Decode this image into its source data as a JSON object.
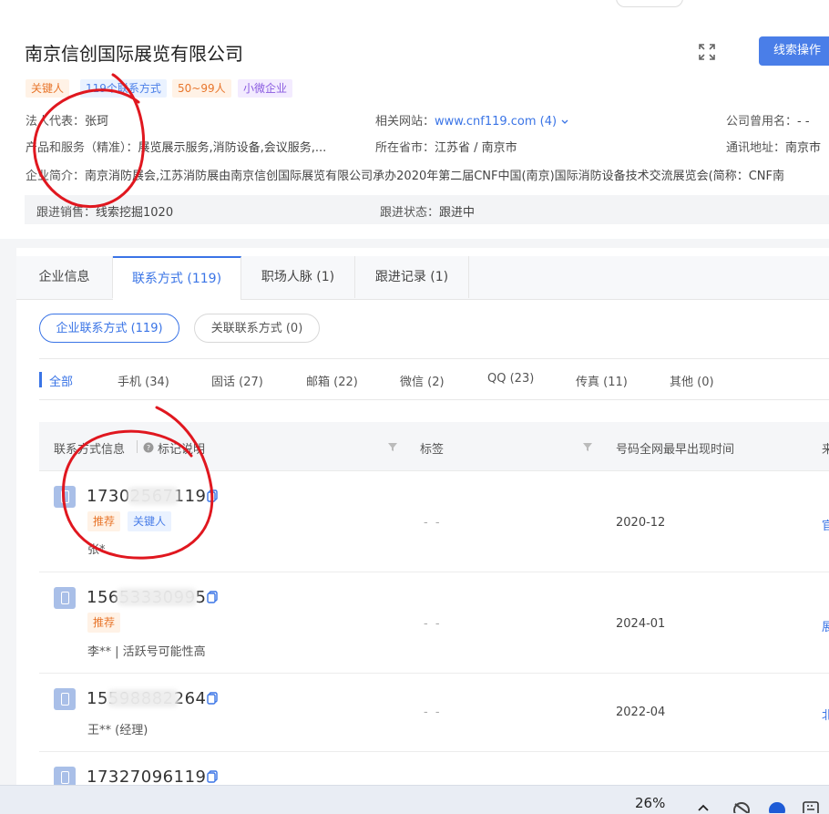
{
  "company": {
    "name": "南京信创国际展览有限公司",
    "lead_button": "线索操作",
    "tags": [
      "关键人",
      "119个联系方式",
      "50~99人",
      "小微企业"
    ],
    "legal_rep_label": "法人代表：",
    "legal_rep": "张珂",
    "website_label": "相关网站：",
    "website": "www.cnf119.com (4)",
    "former_name_label": "公司曾用名：",
    "former_name": "- -",
    "products_label": "产品和服务（精准）：",
    "products": "展览展示服务,消防设备,会议服务,...",
    "city_label": "所在省市：",
    "city": "江苏省 / 南京市",
    "address_label": "通讯地址：",
    "address": "南京市",
    "intro_label": "企业简介：",
    "intro": "南京消防展会,江苏消防展由南京信创国际展览有限公司承办2020年第二届CNF中国(南京)国际消防设备技术交流展览会(简称：CNF南",
    "sales_label": "跟进销售：",
    "sales": "线索挖掘1020",
    "status_label": "跟进状态：",
    "status": "跟进中"
  },
  "tabs": [
    "企业信息",
    "联系方式 (119)",
    "职场人脉 (1)",
    "跟进记录 (1)"
  ],
  "subtabs": [
    "企业联系方式 (119)",
    "关联联系方式 (0)"
  ],
  "filters": [
    "全部",
    "手机 (34)",
    "固话 (27)",
    "邮箱 (22)",
    "微信 (2)",
    "QQ (23)",
    "传真 (11)",
    "其他 (0)"
  ],
  "table": {
    "col_contact": "联系方式信息",
    "col_mark": "标记说明",
    "col_tags": "标签",
    "col_first_seen": "号码全网最早出现时间",
    "col_source_partial": "来"
  },
  "rows": [
    {
      "number": "17302567119",
      "tags": [
        "推荐",
        "关键人"
      ],
      "name": "张*",
      "tag_col": "- -",
      "date": "2020-12",
      "edge": "官"
    },
    {
      "number": "15653330995",
      "tags": [
        "推荐"
      ],
      "name": "李** | 活跃号可能性高",
      "tag_col": "- -",
      "date": "2024-01",
      "edge": "展"
    },
    {
      "number": "15598882264",
      "tags": [],
      "name": "王** (经理)",
      "tag_col": "- -",
      "date": "2022-04",
      "edge": "北"
    },
    {
      "number": "17327096119",
      "tags": [],
      "name": "",
      "tag_col": "",
      "date": "",
      "edge": ""
    }
  ],
  "taskbar": {
    "battery": "26%"
  },
  "colors": {
    "accent": "#3a74e6",
    "button": "#4a7ee8",
    "annotation": "#e0171f"
  }
}
